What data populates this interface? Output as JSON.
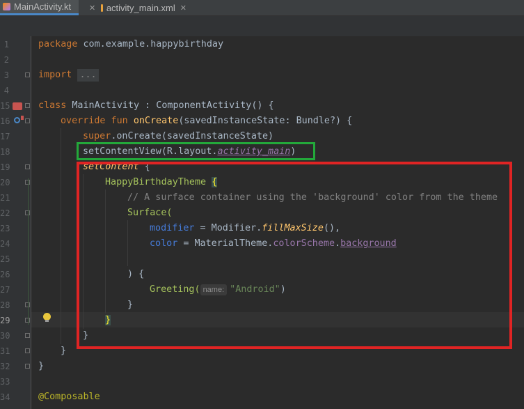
{
  "tabs": [
    {
      "label": "MainActivity.kt",
      "active": true,
      "icon": "kotlin-file-icon"
    },
    {
      "label": "activity_main.xml",
      "active": false,
      "icon": "xml-file-icon"
    }
  ],
  "line_numbers": [
    "1",
    "2",
    "3",
    "4",
    "15",
    "16",
    "17",
    "18",
    "19",
    "20",
    "21",
    "22",
    "23",
    "24",
    "25",
    "26",
    "27",
    "28",
    "29",
    "30",
    "31",
    "32",
    "33",
    "34"
  ],
  "code": {
    "l1_kw": "package",
    "l1_rest": " com.example.happybirthday",
    "l3_kw": "import",
    "l3_fold": "...",
    "l15_kw": "class",
    "l15_rest": " MainActivity : ComponentActivity() {",
    "l16_kw": "override fun",
    "l16_fn": "onCreate",
    "l16_rest": "(savedInstanceState: Bundle?) {",
    "l17_kw": "super",
    "l17_rest": ".onCreate(savedInstanceState)",
    "l18_a": "setContentView(R.layout.",
    "l18_b": "activity_main",
    "l18_c": ")",
    "l19_fn": "setContent",
    "l19_rest": " {",
    "l20_fn": "HappyBirthdayTheme",
    "l20_brace": "{",
    "l21_cm": "// A surface container using the 'background' color from the theme",
    "l22": "Surface(",
    "l23_param": "modifier",
    "l23_eq": " = Modifier.",
    "l23_ext": "fillMaxSize",
    "l23_end": "(),",
    "l24_param": "color",
    "l24_eq": " = MaterialTheme.",
    "l24_p": "colorScheme",
    "l24_dot": ".",
    "l24_u": "background",
    "l26": ") {",
    "l27_fn": "Greeting(",
    "l27_hint": "name:",
    "l27_str": "\"Android\"",
    "l27_end": ")",
    "l28": "}",
    "l29": "}",
    "l30": "}",
    "l31": "}",
    "l32": "}",
    "l34_ann": "@Composable"
  },
  "colors": {
    "background": "#2b2b2b",
    "highlight_green": "#23a83a",
    "highlight_red": "#e02424",
    "tab_accent": "#4a88c7"
  }
}
